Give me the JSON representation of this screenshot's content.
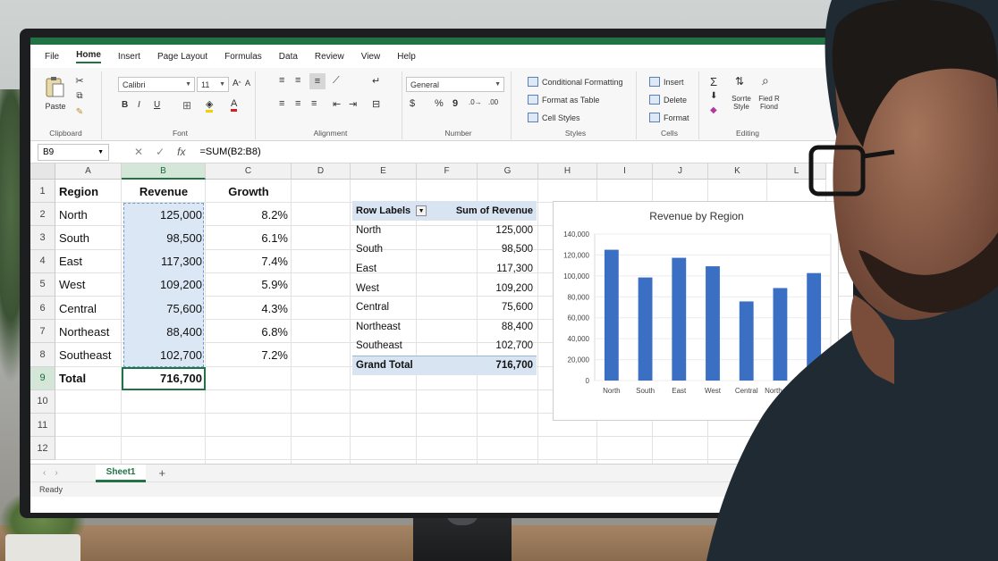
{
  "menu": [
    "File",
    "Home",
    "Insert",
    "Page Layout",
    "Formulas",
    "Data",
    "Review",
    "View",
    "Help"
  ],
  "menu_active": "Home",
  "ribbon": {
    "clipboard": {
      "paste": "Paste",
      "label": "Clipboard"
    },
    "font": {
      "name": "Calibri",
      "size": "11",
      "label": "Font",
      "bold": "B",
      "italic": "I",
      "underline": "U"
    },
    "alignment": {
      "label": "Alignment"
    },
    "number": {
      "format": "General",
      "label": "Number",
      "currency": "$",
      "percent": "%",
      "comma": "9"
    },
    "styles": {
      "conditional": "Conditional Formatting",
      "table": "Format as Table",
      "cell_styles": "Cell Styles",
      "label": "Styles"
    },
    "cells": {
      "insert": "Insert",
      "delete": "Delete",
      "format": "Format",
      "label": "Cells"
    },
    "editing": {
      "sort": "Sorrte",
      "sort2": "Style",
      "find": "Fied R",
      "find2": "Fiond",
      "label": "Editing"
    }
  },
  "formula_bar": {
    "name_box": "B9",
    "formula": "=SUM(B2:B8)"
  },
  "columns": [
    "A",
    "B",
    "C",
    "D",
    "E",
    "F",
    "G",
    "H",
    "I",
    "J",
    "K",
    "L"
  ],
  "rows": [
    "1",
    "2",
    "3",
    "4",
    "5",
    "6",
    "7",
    "8",
    "9",
    "10",
    "11",
    "12"
  ],
  "table": {
    "headers": [
      "Region",
      "Revenue",
      "Growth"
    ],
    "rows": [
      [
        "North",
        "125,000",
        "8.2%"
      ],
      [
        "South",
        "98,500",
        "6.1%"
      ],
      [
        "East",
        "117,300",
        "7.4%"
      ],
      [
        "West",
        "109,200",
        "5.9%"
      ],
      [
        "Central",
        "75,600",
        "4.3%"
      ],
      [
        "Northeast",
        "88,400",
        "6.8%"
      ],
      [
        "Southeast",
        "102,700",
        "7.2%"
      ]
    ],
    "total_label": "Total",
    "total_value": "716,700"
  },
  "pivot": {
    "row_labels": "Row Labels",
    "sum_label": "Sum of Revenue",
    "rows": [
      [
        "North",
        "125,000"
      ],
      [
        "South",
        "98,500"
      ],
      [
        "East",
        "117,300"
      ],
      [
        "West",
        "109,200"
      ],
      [
        "Central",
        "75,600"
      ],
      [
        "Northeast",
        "88,400"
      ],
      [
        "Southeast",
        "102,700"
      ]
    ],
    "grand_total_label": "Grand Total",
    "grand_total_value": "716,700"
  },
  "chart_data": {
    "type": "bar",
    "title": "Revenue by Region",
    "categories": [
      "North",
      "South",
      "East",
      "West",
      "Central",
      "Northeast",
      "Southeast"
    ],
    "values": [
      125000,
      98500,
      117300,
      109200,
      75600,
      88400,
      102700
    ],
    "yticks": [
      "0",
      "20,000",
      "40,000",
      "60,000",
      "80,000",
      "100,000",
      "120,000",
      "140,000"
    ],
    "ylim": [
      0,
      140000
    ],
    "color": "#3a6fc4"
  },
  "sheet_tab": "Sheet1",
  "status": "Ready"
}
